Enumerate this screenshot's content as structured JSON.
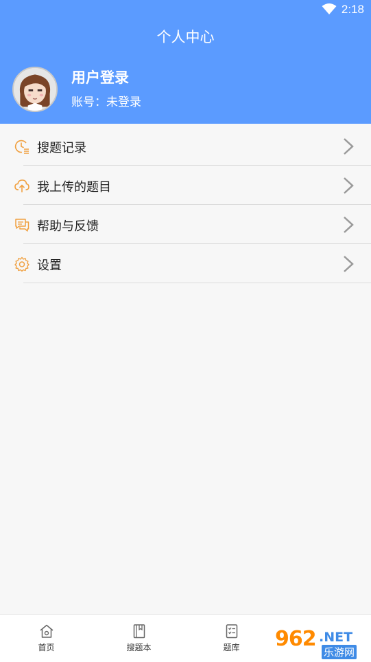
{
  "status_bar": {
    "time": "2:18"
  },
  "header": {
    "title": "个人中心",
    "user_name": "用户登录",
    "account_text": "账号：未登录"
  },
  "menu": {
    "items": [
      {
        "label": "搜题记录",
        "icon": "clock-list-icon"
      },
      {
        "label": "我上传的题目",
        "icon": "cloud-upload-icon"
      },
      {
        "label": "帮助与反馈",
        "icon": "chat-bubbles-icon"
      },
      {
        "label": "设置",
        "icon": "gear-icon"
      }
    ]
  },
  "tabbar": {
    "tabs": [
      {
        "label": "首页",
        "icon": "home-icon"
      },
      {
        "label": "搜题本",
        "icon": "notebook-icon"
      },
      {
        "label": "题库",
        "icon": "checklist-icon"
      }
    ]
  },
  "watermark": {
    "number": "962",
    "suffix": ".NET",
    "cn": "乐游网"
  },
  "colors": {
    "header": "#5b9bff",
    "icon_accent": "#f0a040",
    "background": "#f7f7f7"
  }
}
